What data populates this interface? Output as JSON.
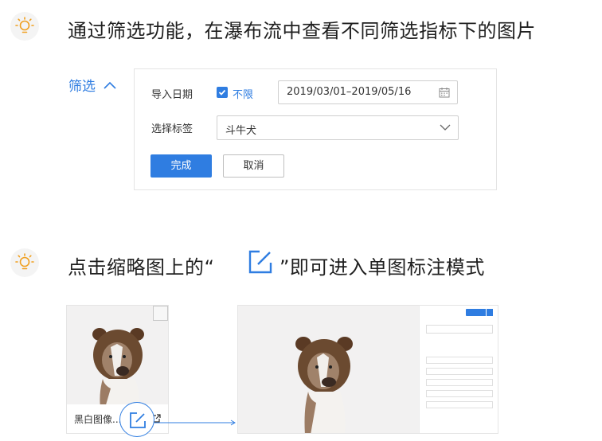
{
  "section1": {
    "title": "通过筛选功能，在瀑布流中查看不同筛选指标下的图片"
  },
  "filter": {
    "toggle_label": "筛选",
    "import_date_label": "导入日期",
    "unlimited_label": "不限",
    "unlimited_checked": true,
    "date_range": "2019/03/01–2019/05/16",
    "tag_label": "选择标签",
    "tag_value": "斗牛犬",
    "confirm_label": "完成",
    "cancel_label": "取消"
  },
  "section2": {
    "title_before": "点击缩略图上的“",
    "title_after": "”即可进入单图标注模式"
  },
  "thumbnail": {
    "caption": "黑白图像..."
  },
  "colors": {
    "accent": "#2f7de1",
    "tip_icon": "#f0a020"
  }
}
